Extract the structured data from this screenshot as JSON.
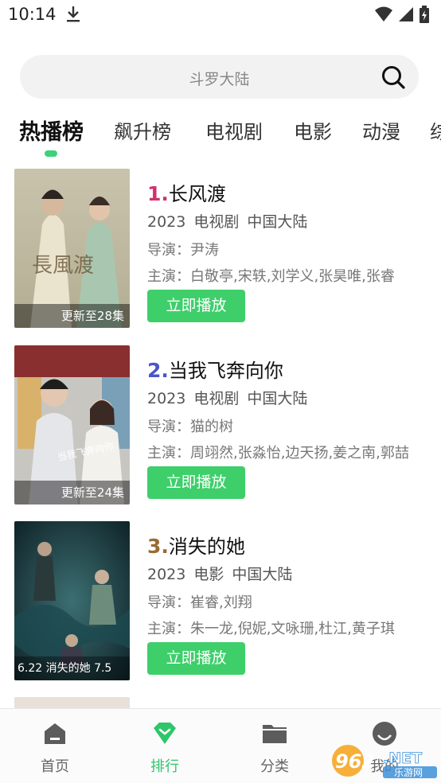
{
  "status": {
    "time": "10:14"
  },
  "search": {
    "placeholder": "斗罗大陆"
  },
  "tabs": [
    "热播榜",
    "飙升榜",
    "电视剧",
    "电影",
    "动漫",
    "综"
  ],
  "items": [
    {
      "rank": "1.",
      "rank_color": "#d3306f",
      "title": "长风渡",
      "meta": "2023 电视剧 中国大陆",
      "director": "导演：尹涛",
      "cast": "主演：白敬亭,宋轶,刘学义,张昊唯,张睿",
      "badge": "更新至28集",
      "button": "立即播放"
    },
    {
      "rank": "2.",
      "rank_color": "#4b55c8",
      "title": "当我飞奔向你",
      "meta": "2023 电视剧 中国大陆",
      "director": "导演：猫的树",
      "cast": "主演：周翊然,张淼怡,边天扬,姜之南,郭喆",
      "badge": "更新至24集",
      "button": "立即播放"
    },
    {
      "rank": "3.",
      "rank_color": "#9a6a33",
      "title": "消失的她",
      "meta": "2023 电影 中国大陆",
      "director": "导演：崔睿,刘翔",
      "cast": "主演：朱一龙,倪妮,文咏珊,杜江,黄子琪",
      "badge": "",
      "poster_text": "6.22 消失的她 7.5",
      "button": "立即播放"
    }
  ],
  "nav": [
    {
      "label": "首页",
      "icon": "home-icon"
    },
    {
      "label": "排行",
      "icon": "ranking-icon"
    },
    {
      "label": "分类",
      "icon": "folder-icon"
    },
    {
      "label": "我的",
      "icon": "profile-icon"
    }
  ],
  "watermark": {
    "text": "962.NET",
    "subtext": "乐游网"
  },
  "colors": {
    "accent": "#3ecf6b",
    "nav_active": "#2fc66a"
  }
}
